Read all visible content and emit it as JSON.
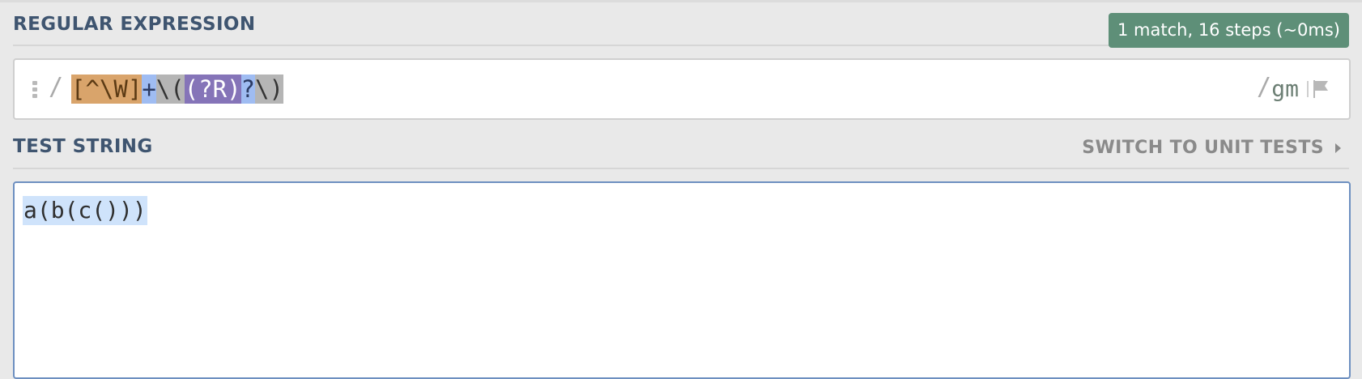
{
  "regex_section": {
    "title": "REGULAR EXPRESSION",
    "match_info": "1 match, 16 steps (~0ms)",
    "open_delimiter": "/",
    "close_delimiter": "/",
    "tokens": [
      {
        "text": "[^\\W]",
        "kind": "charset"
      },
      {
        "text": "+",
        "kind": "quantifier"
      },
      {
        "text": "\\(",
        "kind": "escape"
      },
      {
        "text": "(?R)",
        "kind": "recursion"
      },
      {
        "text": "?",
        "kind": "quantifier"
      },
      {
        "text": "\\)",
        "kind": "escape"
      }
    ],
    "flags": "gm",
    "flag_icon": "flag-icon"
  },
  "test_section": {
    "title": "TEST STRING",
    "switch_label": "SWITCH TO UNIT TESTS",
    "content": "a(b(c()))"
  },
  "colors": {
    "title": "#3f5570",
    "badge": "#5e8f78",
    "charset": "#d9a46b",
    "quantifier": "#9fbcf2",
    "group": "#b5b5b5",
    "recursion": "#8574b8",
    "match_highlight": "#cfe3fb"
  }
}
